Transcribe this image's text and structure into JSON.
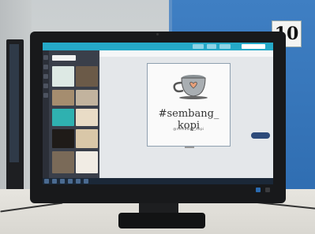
{
  "room": {
    "station_number": "10"
  },
  "screen": {
    "app_logo": "",
    "design": {
      "hashtag": "#sembang_ kopi",
      "handle": "@sembang_kopi",
      "heart_color": "#e8a07a",
      "cup_color": "#a9aeb2"
    }
  },
  "colors": {
    "accent": "#25a9c8",
    "partition_blue": "#3576bb"
  }
}
